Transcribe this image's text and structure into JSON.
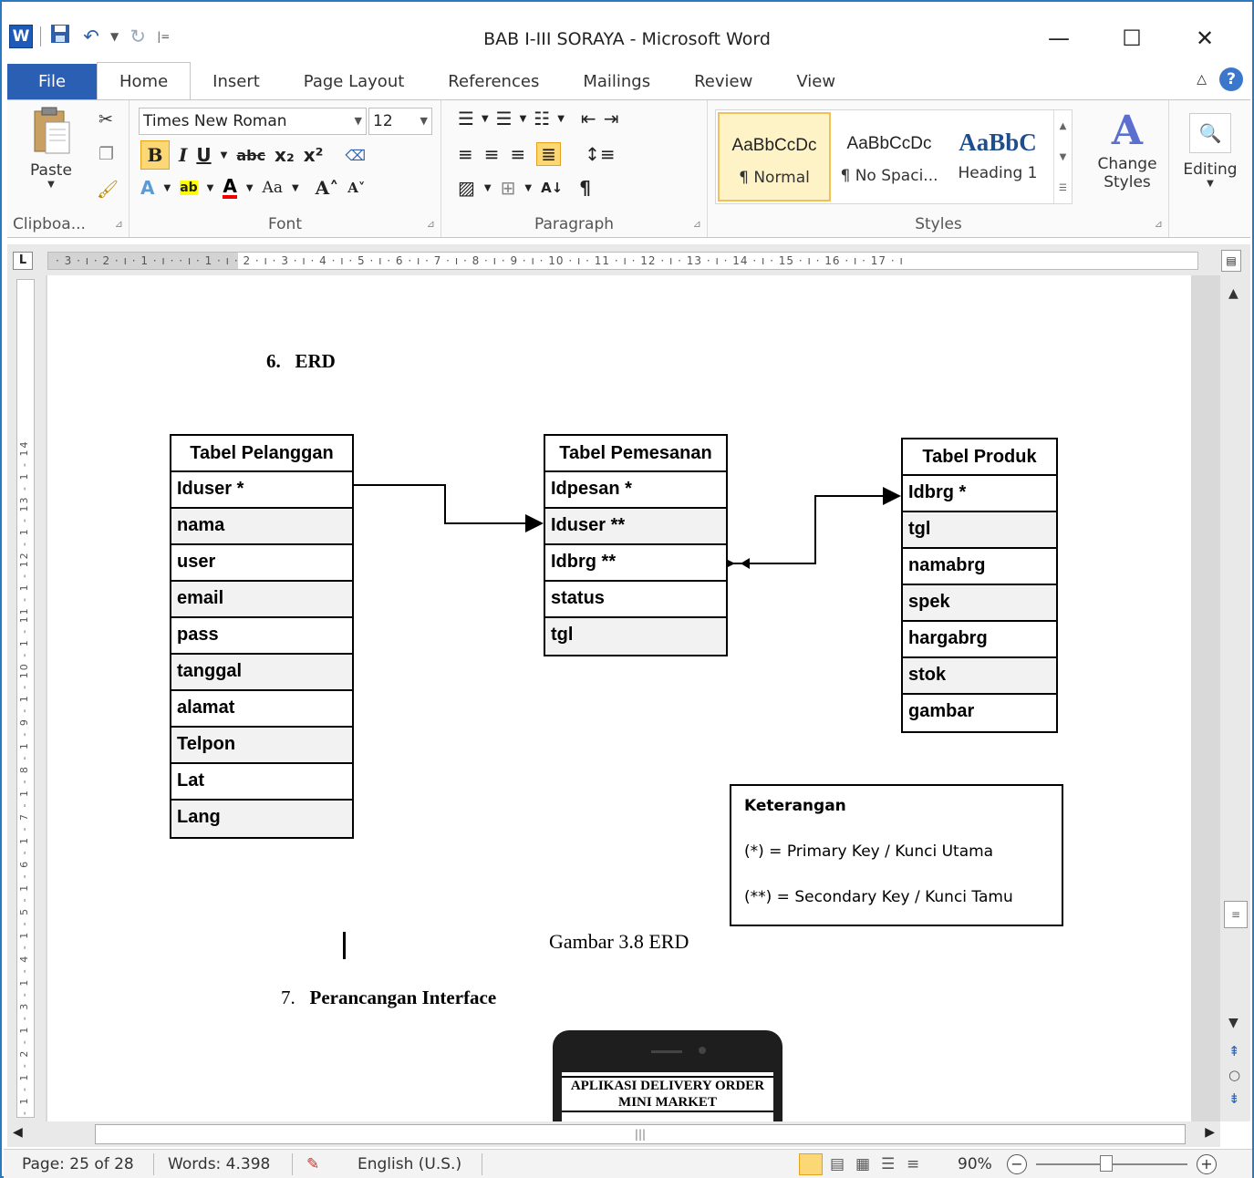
{
  "window": {
    "title": "BAB I-III SORAYA  -  Microsoft Word",
    "app_icon": "W",
    "controls": {
      "minimize": "—",
      "maximize": "☐",
      "close": "✕"
    }
  },
  "quick_access": {
    "save_icon": "save-icon",
    "undo_icon": "undo-icon",
    "redo_icon": "redo-icon",
    "customize": "|="
  },
  "tabs": [
    {
      "label": "File"
    },
    {
      "label": "Home"
    },
    {
      "label": "Insert"
    },
    {
      "label": "Page Layout"
    },
    {
      "label": "References"
    },
    {
      "label": "Mailings"
    },
    {
      "label": "Review"
    },
    {
      "label": "View"
    }
  ],
  "ribbon": {
    "clipboard": {
      "label": "Clipboa...",
      "paste": "Paste"
    },
    "font": {
      "label": "Font",
      "name": "Times New Roman",
      "size": "12",
      "change_case": "Aa"
    },
    "paragraph": {
      "label": "Paragraph",
      "pilcrow": "¶"
    },
    "styles": {
      "label": "Styles",
      "items": [
        {
          "sample": "AaBbCcDc",
          "name": "¶ Normal"
        },
        {
          "sample": "AaBbCcDc",
          "name": "¶ No Spaci..."
        },
        {
          "sample": "AaBbC",
          "name": "Heading 1"
        }
      ],
      "change_styles": "Change Styles",
      "accent": "#f0c05a"
    },
    "editing": {
      "label": "Editing"
    }
  },
  "ruler": {
    "horizontal": "· 3 · ı · 2 · ı · 1 · ı ·       · ı · 1 · ı · 2 · ı · 3 · ı · 4 · ı · 5 · ı · 6 · ı · 7 · ı · 8 · ı · 9 · ı · 10 · ı · 11 · ı · 12 · ı · 13 · ı · 14 · ı · 15 · ı · 16 · ı · 17 · ı",
    "vertical": "- 1 - 1 - 2 - 1 - 3 - 1 - 4 - 1 - 5 - 1 - 6 - 1 - 7 - 1 - 8 - 1 - 9 - 1 - 10 - 1 - 11 - 1 - 12 - 1 - 13 - 1 - 14"
  },
  "document": {
    "section6": {
      "number": "6.",
      "title": "ERD"
    },
    "tables": {
      "pelanggan": {
        "title": "Tabel Pelanggan",
        "rows": [
          "Iduser *",
          "nama",
          "user",
          "email",
          "pass",
          "tanggal",
          "alamat",
          "Telpon",
          "Lat",
          "Lang"
        ]
      },
      "pemesanan": {
        "title": "Tabel Pemesanan",
        "rows": [
          "Idpesan *",
          "Iduser **",
          "Idbrg **",
          "status",
          "tgl"
        ]
      },
      "produk": {
        "title": "Tabel Produk",
        "rows": [
          "Idbrg  *",
          "tgl",
          "namabrg",
          "spek",
          "hargabrg",
          "stok",
          "gambar"
        ]
      }
    },
    "legend": {
      "title": "Keterangan",
      "primary": "(*) = Primary Key / Kunci Utama",
      "secondary": "(**) = Secondary Key / Kunci Tamu"
    },
    "caption": "Gambar 3.8 ERD",
    "section7": {
      "number": "7.",
      "title": "Perancangan Interface"
    },
    "phone_title": "APLIKASI DELIVERY ORDER MINI MARKET"
  },
  "statusbar": {
    "page": "Page: 25 of 28",
    "words": "Words: 4.398",
    "language": "English (U.S.)",
    "zoom": "90%"
  }
}
